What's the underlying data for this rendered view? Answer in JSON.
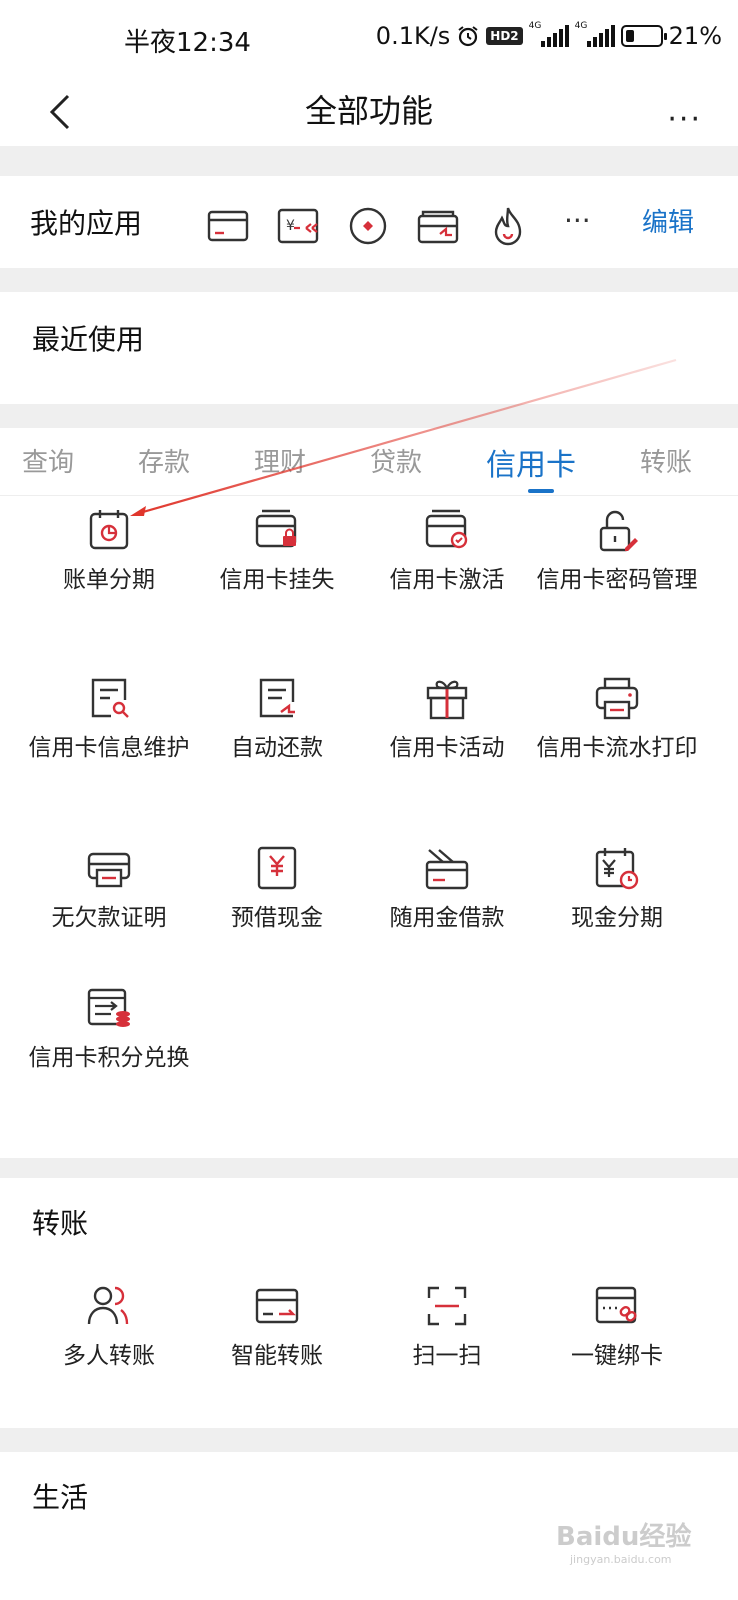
{
  "status": {
    "time": "半夜12:34",
    "speed": "0.1K/s",
    "hd": "HD2",
    "net1": "4G",
    "net2": "4G",
    "battery": "21%"
  },
  "header": {
    "title": "全部功能"
  },
  "my_apps": {
    "label": "我的应用",
    "edit_label": "编辑",
    "more": "···",
    "icons": [
      "card-icon",
      "yen-transfer-icon",
      "coin-icon",
      "wallet-card-icon",
      "flame-icon"
    ]
  },
  "recent": {
    "label": "最近使用"
  },
  "tabs": {
    "items": [
      "查询",
      "存款",
      "理财",
      "贷款",
      "信用卡",
      "转账"
    ],
    "active": "信用卡"
  },
  "credit_card": {
    "items": [
      {
        "label": "账单分期",
        "icon": "calendar-pie-icon"
      },
      {
        "label": "信用卡挂失",
        "icon": "card-lock-icon"
      },
      {
        "label": "信用卡激活",
        "icon": "card-check-icon"
      },
      {
        "label": "信用卡密码管理",
        "icon": "padlock-pen-icon"
      },
      {
        "label": "信用卡信息维护",
        "icon": "doc-search-icon"
      },
      {
        "label": "自动还款",
        "icon": "doc-pen-icon"
      },
      {
        "label": "信用卡活动",
        "icon": "gift-icon"
      },
      {
        "label": "信用卡流水打印",
        "icon": "printer-icon"
      },
      {
        "label": "无欠款证明",
        "icon": "printer-doc-icon"
      },
      {
        "label": "预借现金",
        "icon": "yen-doc-icon"
      },
      {
        "label": "随用金借款",
        "icon": "card-stack-icon"
      },
      {
        "label": "现金分期",
        "icon": "calendar-yen-icon"
      },
      {
        "label": "信用卡积分兑换",
        "icon": "card-coins-icon"
      }
    ]
  },
  "transfer": {
    "title": "转账",
    "items": [
      {
        "label": "多人转账",
        "icon": "users-icon"
      },
      {
        "label": "智能转账",
        "icon": "card-arrow-icon"
      },
      {
        "label": "扫一扫",
        "icon": "scan-icon"
      },
      {
        "label": "一键绑卡",
        "icon": "card-link-icon"
      }
    ]
  },
  "life": {
    "title": "生活"
  },
  "colors": {
    "accent": "#1a73c8",
    "icon_red": "#d6303a",
    "icon_dark": "#333333",
    "annotation": "#e0362c"
  },
  "watermark": {
    "brand": "Baidu经验",
    "url": "jingyan.baidu.com"
  }
}
